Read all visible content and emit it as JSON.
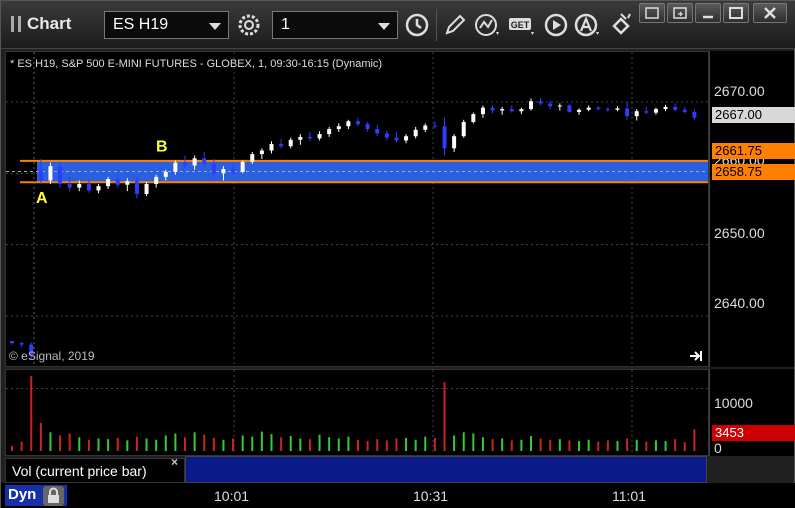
{
  "window": {
    "title": "Chart",
    "symbol": "ES H19",
    "interval": "1"
  },
  "chart": {
    "info_line": "* ES H19, S&P 500 E-MINI FUTURES - GLOBEX, 1, 09:30-16:15 (Dynamic)",
    "copyright": "© eSignal, 2019",
    "price_labels": [
      "2670.00",
      "2660.00",
      "2650.00",
      "2640.00"
    ],
    "last_price_tag": "2667.00",
    "zone_upper_tag": "2661.75",
    "zone_lower_tag": "2658.75",
    "annotation_a": "A",
    "annotation_b": "B",
    "colors": {
      "up": "#ffffff",
      "down": "#2d3cff",
      "zone": "#2a5fe0",
      "zone_line": "#ff7f00",
      "volume_up": "#33cc33",
      "volume_down": "#cc2222"
    }
  },
  "chart_data": {
    "type": "candlestick",
    "ylim": [
      2633,
      2677
    ],
    "zone": [
      2658.75,
      2661.75
    ],
    "ohlc": [
      [
        2636.5,
        2636.5,
        2636,
        2636.2
      ],
      [
        2636.2,
        2636.4,
        2635.6,
        2636
      ],
      [
        2636,
        2636.3,
        2634,
        2634.5
      ],
      [
        2660.5,
        2662,
        2658.5,
        2659
      ],
      [
        2659,
        2661.5,
        2658.5,
        2661
      ],
      [
        2661,
        2661.5,
        2658,
        2658.5
      ],
      [
        2658.5,
        2659.5,
        2657.5,
        2658
      ],
      [
        2658,
        2659,
        2657.5,
        2658.5
      ],
      [
        2658.5,
        2659,
        2657.3,
        2657.6
      ],
      [
        2657.6,
        2658.5,
        2657.2,
        2658.2
      ],
      [
        2658.2,
        2659.5,
        2657.8,
        2659.2
      ],
      [
        2659.2,
        2659.8,
        2658,
        2658.4
      ],
      [
        2658.4,
        2659.3,
        2657.5,
        2658.9
      ],
      [
        2658.9,
        2659.4,
        2656.5,
        2657.1
      ],
      [
        2657.1,
        2658.8,
        2656.8,
        2658.5
      ],
      [
        2658.5,
        2659.8,
        2658,
        2659.5
      ],
      [
        2659.5,
        2660.5,
        2659,
        2660.2
      ],
      [
        2660.2,
        2661.8,
        2659.8,
        2661.5
      ],
      [
        2661.5,
        2662.5,
        2660.8,
        2661.1
      ],
      [
        2661.1,
        2662.5,
        2660.5,
        2662.1
      ],
      [
        2662.1,
        2663,
        2661,
        2661.4
      ],
      [
        2661.4,
        2662,
        2659.5,
        2660
      ],
      [
        2660,
        2661,
        2659,
        2660.6
      ],
      [
        2660.6,
        2661.5,
        2659.8,
        2660.2
      ],
      [
        2660.2,
        2661.8,
        2660,
        2661.6
      ],
      [
        2661.6,
        2663,
        2661.3,
        2662.7
      ],
      [
        2662.7,
        2663.5,
        2662,
        2663.2
      ],
      [
        2663.2,
        2664.5,
        2662.8,
        2664.1
      ],
      [
        2664.1,
        2664.8,
        2663.5,
        2663.8
      ],
      [
        2663.8,
        2665,
        2663.5,
        2664.7
      ],
      [
        2664.7,
        2665.5,
        2664,
        2665.1
      ],
      [
        2665.1,
        2665.8,
        2664.5,
        2664.9
      ],
      [
        2664.9,
        2665.9,
        2664.6,
        2665.5
      ],
      [
        2665.5,
        2666.5,
        2665.1,
        2666.2
      ],
      [
        2666.2,
        2667,
        2665.8,
        2666.6
      ],
      [
        2666.6,
        2667.5,
        2666.2,
        2667.3
      ],
      [
        2667.3,
        2667.8,
        2666.6,
        2666.9
      ],
      [
        2666.9,
        2667.2,
        2665.8,
        2666.2
      ],
      [
        2666.2,
        2666.8,
        2665.2,
        2665.6
      ],
      [
        2665.6,
        2666,
        2664.6,
        2665
      ],
      [
        2665,
        2665.8,
        2664.3,
        2664.6
      ],
      [
        2664.6,
        2665.5,
        2664.2,
        2665.2
      ],
      [
        2665.2,
        2666.5,
        2664.9,
        2666.1
      ],
      [
        2666.1,
        2667,
        2665.8,
        2666.7
      ],
      [
        2666.7,
        2667.3,
        2666.3,
        2666.6
      ],
      [
        2666.6,
        2667.8,
        2662.5,
        2663.5
      ],
      [
        2663.5,
        2665.5,
        2663,
        2665.2
      ],
      [
        2665.2,
        2667.5,
        2665,
        2667.2
      ],
      [
        2667.2,
        2668.5,
        2667,
        2668.3
      ],
      [
        2668.3,
        2669.5,
        2667.8,
        2669.2
      ],
      [
        2669.2,
        2669.6,
        2668.4,
        2668.8
      ],
      [
        2668.8,
        2669.3,
        2668.2,
        2669
      ],
      [
        2669,
        2669.5,
        2668.5,
        2668.7
      ],
      [
        2668.7,
        2669.2,
        2668.3,
        2669
      ],
      [
        2669,
        2670.5,
        2668.8,
        2670.1
      ],
      [
        2670.1,
        2670.6,
        2669.5,
        2669.8
      ],
      [
        2669.8,
        2670.2,
        2669,
        2669.4
      ],
      [
        2669.4,
        2669.8,
        2668.8,
        2669.5
      ],
      [
        2669.5,
        2669.7,
        2668.5,
        2668.6
      ],
      [
        2668.6,
        2669.1,
        2668.2,
        2668.9
      ],
      [
        2668.9,
        2669.5,
        2668.7,
        2669.2
      ],
      [
        2669.2,
        2669.4,
        2668.8,
        2669
      ],
      [
        2669,
        2669.3,
        2668.6,
        2668.9
      ],
      [
        2668.9,
        2669.4,
        2668.7,
        2669.1
      ],
      [
        2669.1,
        2670,
        2667.5,
        2668
      ],
      [
        2668,
        2669,
        2667.4,
        2668.7
      ],
      [
        2668.7,
        2669.3,
        2668.3,
        2668.5
      ],
      [
        2668.5,
        2669.2,
        2668.2,
        2669
      ],
      [
        2669,
        2669.6,
        2668.7,
        2669.3
      ],
      [
        2669.3,
        2669.8,
        2668.7,
        2668.9
      ],
      [
        2668.9,
        2669.3,
        2668.4,
        2668.6
      ],
      [
        2668.6,
        2669,
        2667.5,
        2667.8
      ]
    ],
    "volume": [
      800,
      1500,
      12000,
      4500,
      3000,
      2500,
      2800,
      2200,
      1800,
      2000,
      1900,
      2100,
      1700,
      2300,
      2000,
      1800,
      2500,
      2800,
      2200,
      3000,
      2600,
      2100,
      1800,
      2000,
      2500,
      2300,
      3100,
      2700,
      2200,
      2400,
      2000,
      1900,
      2600,
      2200,
      2000,
      2300,
      1800,
      1600,
      1900,
      1700,
      2000,
      2100,
      1800,
      2300,
      2100,
      11000,
      2500,
      3000,
      2800,
      2200,
      1900,
      2000,
      1700,
      1800,
      2400,
      2000,
      1800,
      1900,
      1700,
      1600,
      1800,
      1500,
      1700,
      1600,
      2000,
      1800,
      1500,
      1700,
      1600,
      1900,
      1400,
      3453
    ],
    "volume_ylim": [
      0,
      12000
    ],
    "volume_labels": [
      "10000",
      "0"
    ],
    "last_volume_tag": "3453",
    "time_labels": [
      "10:01",
      "10:31",
      "11:01"
    ]
  },
  "volume_panel": {
    "label": "Vol (current price bar)",
    "close_glyph": "×"
  },
  "status": {
    "mode": "Dyn"
  }
}
